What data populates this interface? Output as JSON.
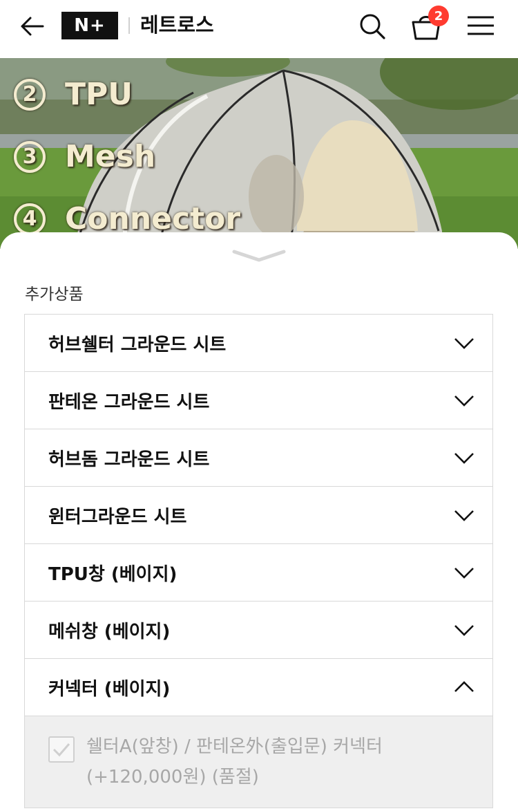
{
  "header": {
    "logo_text": "N+",
    "store_name": "레트로스",
    "cart_count": "2",
    "icons": {
      "back": "arrow-left-icon",
      "search": "search-icon",
      "cart": "cart-icon",
      "menu": "hamburger-menu-icon"
    }
  },
  "hero": {
    "lines": [
      {
        "num": "2",
        "text": "TPU"
      },
      {
        "num": "3",
        "text": "Mesh"
      },
      {
        "num": "4",
        "text": "Connector"
      }
    ]
  },
  "sheet": {
    "section_label": "추가상품",
    "items": [
      {
        "label": "허브쉘터 그라운드 시트",
        "expanded": false
      },
      {
        "label": "판테온 그라운드 시트",
        "expanded": false
      },
      {
        "label": "허브돔 그라운드 시트",
        "expanded": false
      },
      {
        "label": "윈터그라운드 시트",
        "expanded": false
      },
      {
        "label": "TPU창 (베이지)",
        "expanded": false
      },
      {
        "label": "메쉬창 (베이지)",
        "expanded": false
      },
      {
        "label": "커넥터 (베이지)",
        "expanded": true
      }
    ],
    "expanded_option": {
      "line1": "쉘터A(앞창) / 판테온外(출입문) 커넥터",
      "line2": "(+120,000원) (품절)"
    }
  },
  "colors": {
    "badge": "#ff3b30",
    "logo_bg": "#111111",
    "disabled_text": "#a7a7a7",
    "panel_bg": "#efefef"
  }
}
